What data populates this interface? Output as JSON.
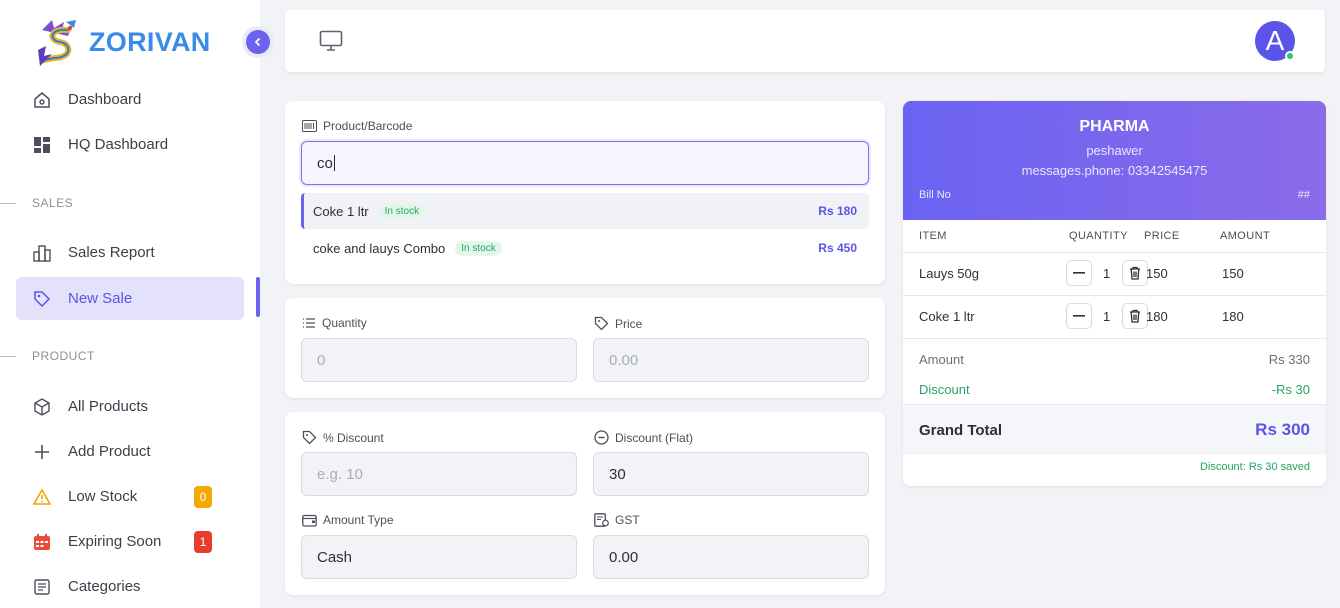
{
  "brand": {
    "name": "ZORIVAN",
    "color": "#3a8be8",
    "accent": "#6b62f0"
  },
  "sidebar": {
    "items": [
      {
        "label": "Dashboard",
        "icon": "home-icon"
      },
      {
        "label": "HQ Dashboard",
        "icon": "grid-icon"
      },
      {
        "label": "Sales Report",
        "icon": "bar-chart-icon"
      },
      {
        "label": "New Sale",
        "icon": "tag-icon",
        "active": true
      },
      {
        "label": "All Products",
        "icon": "box-icon"
      },
      {
        "label": "Add Product",
        "icon": "plus-icon"
      },
      {
        "label": "Low Stock",
        "icon": "warning-icon",
        "badge": "0"
      },
      {
        "label": "Expiring Soon",
        "icon": "calendar-icon",
        "badge": "1"
      },
      {
        "label": "Categories",
        "icon": "list-icon"
      }
    ],
    "sections": {
      "sales": "SALES",
      "product": "PRODUCT"
    }
  },
  "topbar": {
    "avatar_initial": "A"
  },
  "product_search": {
    "label": "Product/Barcode",
    "value": "co",
    "suggestions": [
      {
        "name": "Coke 1 ltr",
        "stock": "In stock",
        "price": "Rs 180"
      },
      {
        "name": "coke and lauys Combo",
        "stock": "In stock",
        "price": "Rs 450"
      }
    ]
  },
  "fields": {
    "quantity": {
      "label": "Quantity",
      "placeholder": "0"
    },
    "price": {
      "label": "Price",
      "placeholder": "0.00"
    },
    "discount_percent": {
      "label": "% Discount",
      "placeholder": "e.g. 10"
    },
    "discount_flat": {
      "label": "Discount (Flat)",
      "value": "30"
    },
    "amount_type": {
      "label": "Amount Type",
      "value": "Cash"
    },
    "gst": {
      "label": "GST",
      "value": "0.00"
    }
  },
  "bill": {
    "store": "PHARMA",
    "city": "peshawer",
    "phone": "messages.phone: 03342545475",
    "bill_no_label": "Bill No",
    "bill_no_value": "##",
    "headers": {
      "item": "ITEM",
      "quantity": "QUANTITY",
      "price": "PRICE",
      "amount": "AMOUNT"
    },
    "rows": [
      {
        "item": "Lauys 50g",
        "qty": "1",
        "price": "150",
        "amount": "150"
      },
      {
        "item": "Coke 1 ltr",
        "qty": "1",
        "price": "180",
        "amount": "180"
      }
    ],
    "amount_label": "Amount",
    "amount_value": "Rs 330",
    "discount_label": "Discount",
    "discount_value": "-Rs 30",
    "grand_label": "Grand Total",
    "grand_value": "Rs 300",
    "saved_note": "Discount: Rs 30 saved"
  }
}
